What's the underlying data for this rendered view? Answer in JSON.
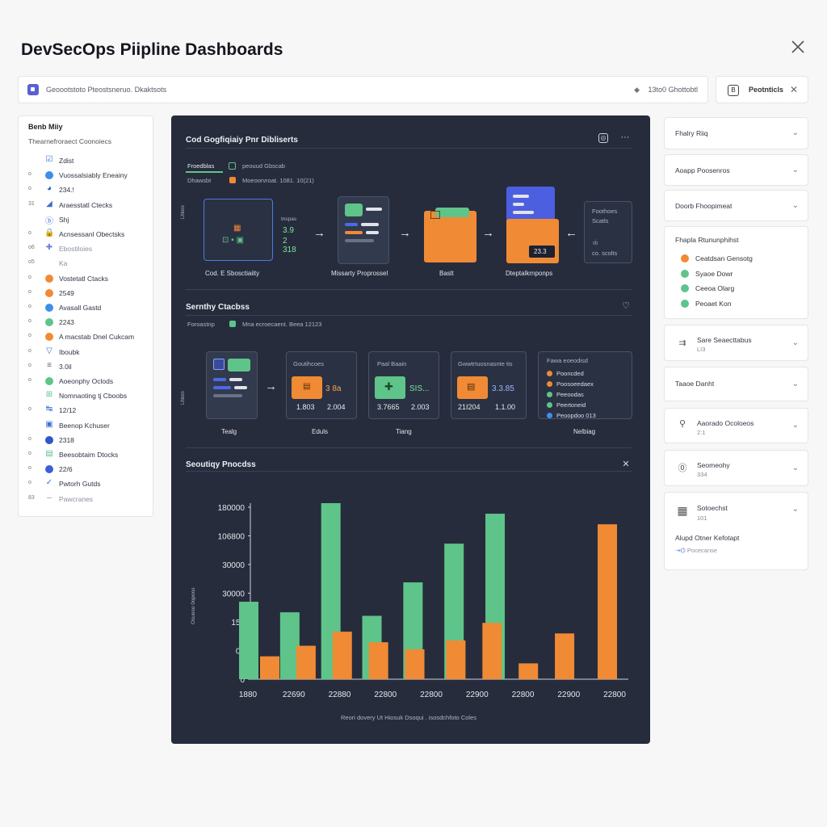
{
  "header": {
    "title": "DevSecOps Piipline Dashboards"
  },
  "search": {
    "text": "Geoootstoto Pteostsneruo. Dkaktsots",
    "right_text": "13to0 Ghottobtl",
    "right_icon": "◆"
  },
  "filter": {
    "label": "Peotnticls",
    "icon": "B"
  },
  "sidebar": {
    "title": "Benb Miiy",
    "subtitle": "Thearnefroraect Coonoiecs",
    "items": [
      {
        "num": "",
        "label": "Zdist",
        "marker": "glyph",
        "glyph": "☑",
        "color": "#3b6fd6"
      },
      {
        "num": "o",
        "label": "Vuossalsiably Eneainy",
        "marker": "dot",
        "color": "#3d8fe8"
      },
      {
        "num": "o",
        "label": "234.!",
        "marker": "glyph",
        "glyph": "◕",
        "color": "#2f5fc6"
      },
      {
        "num": "31",
        "label": "Araesstatl Ctecks",
        "marker": "glyph",
        "glyph": "◢",
        "color": "#3b6fd6"
      },
      {
        "num": "",
        "label": "Shj",
        "marker": "glyph",
        "glyph": "ⓑ",
        "color": "#3b6fd6"
      },
      {
        "num": "o",
        "label": "Acnsessanl Obectsks",
        "marker": "glyph",
        "glyph": "🔒",
        "color": "#3b6fd6"
      },
      {
        "num": "o6",
        "label": "Ebostiloies",
        "marker": "glyph",
        "glyph": "✚",
        "color": "#6a7dd8",
        "muted": true
      },
      {
        "num": "o5",
        "label": "Ka",
        "marker": "none",
        "muted": true
      },
      {
        "num": "o",
        "label": "Vostetatl Ctacks",
        "marker": "dot",
        "color": "#f08a35"
      },
      {
        "num": "o",
        "label": "2549",
        "marker": "dot",
        "color": "#f08a35"
      },
      {
        "num": "o",
        "label": "Avasall Gastd",
        "marker": "dot",
        "color": "#3d8fe8"
      },
      {
        "num": "o",
        "label": "2243",
        "marker": "dot",
        "color": "#5fc48a"
      },
      {
        "num": "o",
        "label": "A macstab Dnel Cukcam",
        "marker": "dot",
        "color": "#f08a35"
      },
      {
        "num": "o",
        "label": "Iboubk",
        "marker": "glyph",
        "glyph": "▽",
        "color": "#3b6fd6"
      },
      {
        "num": "o",
        "label": "3.0il",
        "marker": "glyph",
        "glyph": "≡",
        "color": "#666"
      },
      {
        "num": "o",
        "label": "Aoeonphy Oclods",
        "marker": "dot",
        "color": "#5fc48a"
      },
      {
        "num": "",
        "label": "Nomnaoting tj Cboobs",
        "marker": "glyph",
        "glyph": "⊞",
        "color": "#5fc48a"
      },
      {
        "num": "o",
        "label": "12/12",
        "marker": "glyph",
        "glyph": "↹",
        "color": "#3b6fd6"
      },
      {
        "num": "",
        "label": "Beenop Kchuser",
        "marker": "glyph",
        "glyph": "▣",
        "color": "#3b6fd6"
      },
      {
        "num": "o",
        "label": "2318",
        "marker": "dot",
        "color": "#2f55c6"
      },
      {
        "num": "o",
        "label": "Beesobtaim Dtocks",
        "marker": "glyph",
        "glyph": "▤",
        "color": "#5fc48a"
      },
      {
        "num": "o",
        "label": "22/6",
        "marker": "dot",
        "color": "#3b5fd6"
      },
      {
        "num": "o",
        "label": "Pwtorh Gutds",
        "marker": "glyph",
        "glyph": "✓",
        "color": "#3b6fd6"
      },
      {
        "num": "83",
        "label": "Pawcranes",
        "marker": "glyph",
        "glyph": "–",
        "color": "#888",
        "muted": true
      }
    ]
  },
  "main": {
    "section1": {
      "title": "Cod Gogfiqiaiy Pnr Dibliserts",
      "tab_active": "Froedblas",
      "tab_right": "peouud Gbscab",
      "row2_left": "Dhawsbt",
      "row2_right": "Moeoorvroat. 1081. 10(21)",
      "stages": [
        "Cod. E Sbosctiaiity",
        "Missarty Proprossel",
        "Baslt",
        "Dteptalkrnponps"
      ],
      "card1_num_a": "3.9",
      "card1_num_b": "2 318",
      "card1_label": "tnspas",
      "card4_num": "23.3",
      "side_card_a": "Foothoes",
      "side_card_b": "Scatls",
      "side_card_c": "co. scolts"
    },
    "section2": {
      "title": "Sernthy Ctacbss",
      "row_left": "Foroastnp",
      "row_right": "Mna ecroecaent. Beea 12123",
      "stages": [
        "Tealg",
        "Eduls",
        "Tiang",
        "Nelbiag"
      ],
      "box1_title": "Goutihcoes",
      "box1_num_a": "3 8a",
      "box1_num_b": "1.803",
      "box1_num_c": "2.004",
      "box2_title": "Paal Baain",
      "box2_num_a": "SIS...",
      "box2_num_b": "3.7665",
      "box2_num_c": "2.003",
      "box3_title": "Gwwtrtuosnasnte tis",
      "box3_num_a": "3.3.85",
      "box3_num_b": "21I204",
      "box3_num_c": "1.1.00",
      "box4_title": "Fawa eoeodisd",
      "box4_items": [
        {
          "label": "Pooncded",
          "color": "#f08a35"
        },
        {
          "label": "Poosoeedaex",
          "color": "#f08a35"
        },
        {
          "label": "Peeoodas",
          "color": "#5fc48a"
        },
        {
          "label": "Peertoneid",
          "color": "#5fc48a"
        },
        {
          "label": "Peoopdoo 013",
          "color": "#3d8fe8"
        }
      ]
    },
    "chart_title": "Seoutiqy Pnocdss",
    "chart_caption": "Reori dovery Ut Hiosuk Dsoqui . isosdchfoto Coles"
  },
  "chart_data": {
    "type": "bar",
    "title": "Seoutiqy Pnocdss",
    "y_tick_labels": [
      "0",
      "00",
      "150",
      "30000",
      "30000",
      "106800",
      "180000"
    ],
    "x_tick_labels": [
      "1880",
      "22690",
      "22880",
      "22800",
      "22800",
      "22900",
      "22800",
      "22900",
      "22800"
    ],
    "series": [
      {
        "color": "#5fc48a",
        "values": [
          0.44,
          0.38,
          1.0,
          0.36,
          0.55,
          0.77,
          0.94,
          0.0
        ]
      },
      {
        "color": "#f08a35",
        "values": [
          0.13,
          0.19,
          0.27,
          0.21,
          0.17,
          0.22,
          0.32,
          0.09,
          0.26,
          0.88
        ]
      }
    ],
    "ylim": [
      0,
      1
    ],
    "grid": false
  },
  "right_panel": {
    "items": [
      {
        "label": "Fhalry Riiq"
      },
      {
        "label": "Aoapp Poosenros"
      },
      {
        "label": "Doorb Fhoopimeat"
      }
    ],
    "legend_title": "Fhapla Rtununphihst",
    "legend": [
      {
        "label": "Ceatdsan Gensotg",
        "color": "#f08a35"
      },
      {
        "label": "Syaoe Dowr",
        "color": "#5fc48a"
      },
      {
        "label": "Ceeoa Olarg",
        "color": "#5fc48a"
      },
      {
        "label": "Peoaet Kon",
        "color": "#5fc48a"
      }
    ],
    "cards": [
      {
        "label": "Sare Seaecttabus",
        "sub": "LI3",
        "icon": "⇉"
      },
      {
        "label": "Taaoe Danht",
        "sub": "",
        "icon": ""
      },
      {
        "label": "Aaorado Ocoloeos",
        "sub": "2:1",
        "icon": "⚲"
      },
      {
        "label": "Seomeohy",
        "sub": "334",
        "icon": "⓪"
      },
      {
        "label": "Sotoechst",
        "sub": "101",
        "icon": "▦",
        "extra": "Alupd Otner Kefotapt",
        "extra2": "Pocecanse"
      }
    ]
  }
}
